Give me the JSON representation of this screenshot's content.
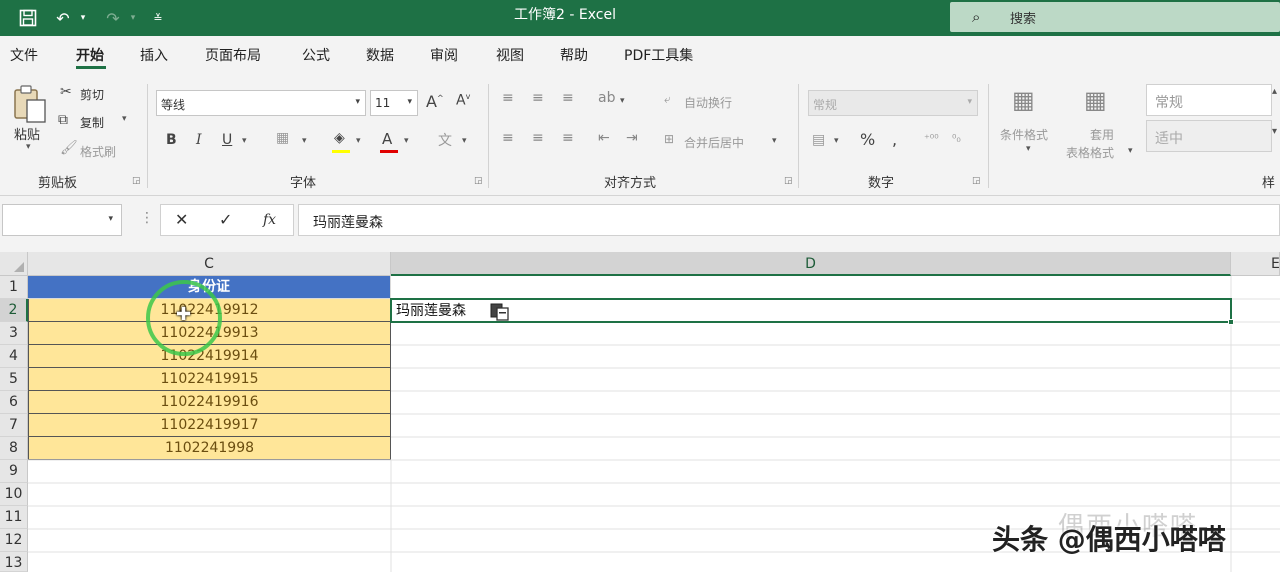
{
  "window": {
    "title": "工作簿2 - Excel",
    "search_placeholder": "搜索"
  },
  "menu": {
    "tabs": [
      {
        "label": "文件"
      },
      {
        "label": "开始",
        "active": true
      },
      {
        "label": "插入"
      },
      {
        "label": "页面布局"
      },
      {
        "label": "公式"
      },
      {
        "label": "数据"
      },
      {
        "label": "审阅"
      },
      {
        "label": "视图"
      },
      {
        "label": "帮助"
      },
      {
        "label": "PDF工具集"
      }
    ]
  },
  "ribbon": {
    "clipboard": {
      "paste": "粘贴",
      "cut": "剪切",
      "copy": "复制",
      "format_painter": "格式刷",
      "label": "剪贴板"
    },
    "font": {
      "font_name": "等线",
      "font_size": "11",
      "label": "字体"
    },
    "alignment": {
      "wrap_text": "自动换行",
      "merge_center": "合并后居中",
      "label": "对齐方式"
    },
    "number": {
      "format": "常规",
      "label": "数字"
    },
    "styles": {
      "conditional": "条件格式",
      "table_line1": "套用",
      "table_line2": "表格格式",
      "style_normal": "常规",
      "style_neutral": "适中",
      "label_partial": "样"
    }
  },
  "formula_bar": {
    "name_box": "",
    "value": "玛丽莲曼森"
  },
  "sheet": {
    "columns": [
      "C",
      "D",
      "E"
    ],
    "rows": [
      "1",
      "2",
      "3",
      "4",
      "5",
      "6",
      "7",
      "8",
      "9",
      "10",
      "11",
      "12",
      "13"
    ],
    "column_c": [
      "身份证",
      "11022419912",
      "11022419913",
      "11022419914",
      "11022419915",
      "11022419916",
      "11022419917",
      "1102241998"
    ],
    "d2": "玛丽莲曼森"
  },
  "watermark": {
    "text": "头条 @偶西小嗒嗒",
    "faint_text": "偶西小嗒嗒"
  },
  "colors": {
    "excel_green": "#1e7145",
    "header_blue": "#4472c4",
    "yellow_fill": "#ffe699",
    "cursor_ring": "#3cc74a"
  }
}
